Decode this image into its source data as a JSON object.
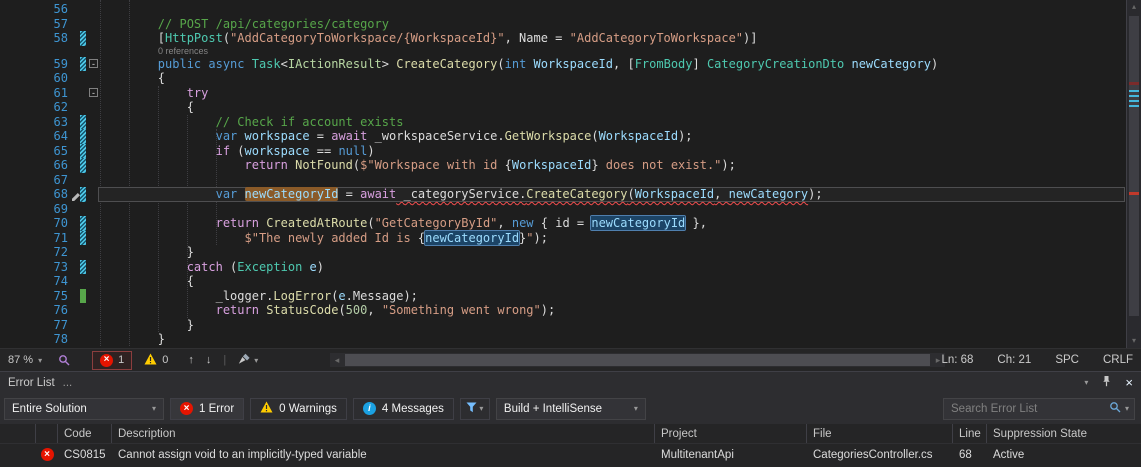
{
  "colors": {
    "editor_background": "#1E1E1E",
    "panel_background": "#2D2D30",
    "error_red": "#E51400",
    "warning_yellow": "#FFCC00",
    "info_blue": "#1BA1E2",
    "reference_highlight": "#1C4466",
    "definition_highlight": "#8A5A28"
  },
  "icons": [
    "error-icon",
    "warning-icon",
    "info-icon",
    "filter-icon",
    "search-icon",
    "pin-icon",
    "close-icon",
    "chevron-down-icon",
    "broom-icon",
    "zoom-icon",
    "pencil-icon",
    "arrow-up-icon",
    "arrow-down-icon"
  ],
  "editor": {
    "statusbar": {
      "zoom": "87 %",
      "error_count": "1",
      "warning_count": "0",
      "line_indicator": "Ln: 68",
      "column_indicator": "Ch: 21",
      "insert_mode": "SPC",
      "line_ending": "CRLF"
    },
    "lines": [
      {
        "n": 56,
        "tokens": []
      },
      {
        "n": 57,
        "tokens": [
          {
            "t": "        // POST /api/categories/category",
            "c": "com"
          }
        ]
      },
      {
        "n": 58,
        "mark": "blue",
        "tokens": [
          {
            "t": "        [",
            "c": "d"
          },
          {
            "t": "HttpPost",
            "c": "t"
          },
          {
            "t": "(",
            "c": "d"
          },
          {
            "t": "\"AddCategoryToWorkspace/{WorkspaceId}\"",
            "c": "s"
          },
          {
            "t": ", Name = ",
            "c": "d"
          },
          {
            "t": "\"AddCategoryToWorkspace\"",
            "c": "s"
          },
          {
            "t": ")]",
            "c": "d"
          }
        ]
      },
      {
        "n": 59,
        "mark": "blue",
        "fold": true,
        "lens": "0 references",
        "tokens": [
          {
            "t": "        public async ",
            "c": "k"
          },
          {
            "t": "Task",
            "c": "t"
          },
          {
            "t": "<",
            "c": "d"
          },
          {
            "t": "IActionResult",
            "c": "i"
          },
          {
            "t": "> ",
            "c": "d"
          },
          {
            "t": "CreateCategory",
            "c": "m"
          },
          {
            "t": "(",
            "c": "d"
          },
          {
            "t": "int ",
            "c": "k"
          },
          {
            "t": "WorkspaceId",
            "c": "v"
          },
          {
            "t": ", [",
            "c": "d"
          },
          {
            "t": "FromBody",
            "c": "t"
          },
          {
            "t": "] ",
            "c": "d"
          },
          {
            "t": "CategoryCreationDto",
            "c": "t"
          },
          {
            "t": " ",
            "c": "d"
          },
          {
            "t": "newCategory",
            "c": "v"
          },
          {
            "t": ")",
            "c": "d"
          }
        ]
      },
      {
        "n": 60,
        "tokens": [
          {
            "t": "        {",
            "c": "d"
          }
        ]
      },
      {
        "n": 61,
        "fold": true,
        "tokens": [
          {
            "t": "            ",
            "c": "d"
          },
          {
            "t": "try",
            "c": "c"
          }
        ]
      },
      {
        "n": 62,
        "tokens": [
          {
            "t": "            {",
            "c": "d"
          }
        ]
      },
      {
        "n": 63,
        "mark": "blue",
        "tokens": [
          {
            "t": "                // Check if account exists",
            "c": "com"
          }
        ]
      },
      {
        "n": 64,
        "mark": "blue",
        "tokens": [
          {
            "t": "                ",
            "c": "d"
          },
          {
            "t": "var",
            "c": "k"
          },
          {
            "t": " ",
            "c": "d"
          },
          {
            "t": "workspace",
            "c": "v"
          },
          {
            "t": " = ",
            "c": "d"
          },
          {
            "t": "await",
            "c": "c"
          },
          {
            "t": " _workspaceService.",
            "c": "d"
          },
          {
            "t": "GetWorkspace",
            "c": "m"
          },
          {
            "t": "(",
            "c": "d"
          },
          {
            "t": "WorkspaceId",
            "c": "v"
          },
          {
            "t": ");",
            "c": "d"
          }
        ]
      },
      {
        "n": 65,
        "mark": "blue",
        "tokens": [
          {
            "t": "                ",
            "c": "d"
          },
          {
            "t": "if",
            "c": "c"
          },
          {
            "t": " (",
            "c": "d"
          },
          {
            "t": "workspace",
            "c": "v"
          },
          {
            "t": " == ",
            "c": "d"
          },
          {
            "t": "null",
            "c": "k"
          },
          {
            "t": ")",
            "c": "d"
          }
        ]
      },
      {
        "n": 66,
        "mark": "blue",
        "tokens": [
          {
            "t": "                    ",
            "c": "d"
          },
          {
            "t": "return",
            "c": "c"
          },
          {
            "t": " ",
            "c": "d"
          },
          {
            "t": "NotFound",
            "c": "m"
          },
          {
            "t": "(",
            "c": "d"
          },
          {
            "t": "$\"Workspace with id ",
            "c": "s"
          },
          {
            "t": "{",
            "c": "d"
          },
          {
            "t": "WorkspaceId",
            "c": "v"
          },
          {
            "t": "}",
            "c": "d"
          },
          {
            "t": " does not exist.\"",
            "c": "s"
          },
          {
            "t": ");",
            "c": "d"
          }
        ]
      },
      {
        "n": 67,
        "tokens": []
      },
      {
        "n": 68,
        "mark": "blue",
        "current": true,
        "tokens": [
          {
            "t": "                ",
            "c": "d"
          },
          {
            "t": "var",
            "c": "k"
          },
          {
            "t": " ",
            "c": "d"
          },
          {
            "t": "newCategoryId",
            "c": "v",
            "hl": "def"
          },
          {
            "t": " = ",
            "c": "d"
          },
          {
            "t": "await",
            "c": "c"
          },
          {
            "t": " _categoryService.",
            "c": "d",
            "sq": true
          },
          {
            "t": "CreateCategory",
            "c": "m",
            "sq": true
          },
          {
            "t": "(",
            "c": "d",
            "sq": true
          },
          {
            "t": "WorkspaceId",
            "c": "v",
            "sq": true
          },
          {
            "t": ", ",
            "c": "d",
            "sq": true
          },
          {
            "t": "newCategory",
            "c": "v",
            "sq": true
          },
          {
            "t": ");",
            "c": "d"
          }
        ]
      },
      {
        "n": 69,
        "tokens": []
      },
      {
        "n": 70,
        "mark": "blue",
        "tokens": [
          {
            "t": "                ",
            "c": "d"
          },
          {
            "t": "return",
            "c": "c"
          },
          {
            "t": " ",
            "c": "d"
          },
          {
            "t": "CreatedAtRoute",
            "c": "m"
          },
          {
            "t": "(",
            "c": "d"
          },
          {
            "t": "\"GetCategoryById\"",
            "c": "s"
          },
          {
            "t": ", ",
            "c": "d"
          },
          {
            "t": "new",
            "c": "k"
          },
          {
            "t": " { id = ",
            "c": "d"
          },
          {
            "t": "newCategoryId",
            "c": "v",
            "hl": "ref"
          },
          {
            "t": " },",
            "c": "d"
          }
        ]
      },
      {
        "n": 71,
        "mark": "blue",
        "tokens": [
          {
            "t": "                    ",
            "c": "d"
          },
          {
            "t": "$\"The newly added Id is ",
            "c": "s"
          },
          {
            "t": "{",
            "c": "d"
          },
          {
            "t": "newCategoryId",
            "c": "v",
            "hl": "ref"
          },
          {
            "t": "}",
            "c": "d"
          },
          {
            "t": "\"",
            "c": "s"
          },
          {
            "t": ");",
            "c": "d"
          }
        ]
      },
      {
        "n": 72,
        "tokens": [
          {
            "t": "            }",
            "c": "d"
          }
        ]
      },
      {
        "n": 73,
        "mark": "blue",
        "tokens": [
          {
            "t": "            ",
            "c": "d"
          },
          {
            "t": "catch",
            "c": "c"
          },
          {
            "t": " (",
            "c": "d"
          },
          {
            "t": "Exception",
            "c": "t"
          },
          {
            "t": " ",
            "c": "d"
          },
          {
            "t": "e",
            "c": "v"
          },
          {
            "t": ")",
            "c": "d"
          }
        ]
      },
      {
        "n": 74,
        "tokens": [
          {
            "t": "            {",
            "c": "d"
          }
        ]
      },
      {
        "n": 75,
        "mark": "green",
        "tokens": [
          {
            "t": "                _logger.",
            "c": "d"
          },
          {
            "t": "LogError",
            "c": "m"
          },
          {
            "t": "(",
            "c": "d"
          },
          {
            "t": "e",
            "c": "v"
          },
          {
            "t": ".Message);",
            "c": "d"
          }
        ]
      },
      {
        "n": 76,
        "tokens": [
          {
            "t": "                ",
            "c": "d"
          },
          {
            "t": "return",
            "c": "c"
          },
          {
            "t": " ",
            "c": "d"
          },
          {
            "t": "StatusCode",
            "c": "m"
          },
          {
            "t": "(",
            "c": "d"
          },
          {
            "t": "500",
            "c": "n"
          },
          {
            "t": ", ",
            "c": "d"
          },
          {
            "t": "\"Something went wrong\"",
            "c": "s"
          },
          {
            "t": ");",
            "c": "d"
          }
        ]
      },
      {
        "n": 77,
        "tokens": [
          {
            "t": "            }",
            "c": "d"
          }
        ]
      },
      {
        "n": 78,
        "tokens": [
          {
            "t": "        }",
            "c": "d"
          }
        ]
      }
    ]
  },
  "error_list": {
    "title": "Error List",
    "title_ellipsis": "...",
    "toolbar": {
      "scope_filter": "Entire Solution",
      "errors_button": "1 Error",
      "warnings_button": "0 Warnings",
      "messages_button": "4 Messages",
      "source_filter": "Build + IntelliSense",
      "search_placeholder": "Search Error List"
    },
    "columns": {
      "code": "Code",
      "description": "Description",
      "project": "Project",
      "file": "File",
      "line": "Line",
      "suppression": "Suppression State"
    },
    "rows": [
      {
        "severity": "error",
        "code": "CS0815",
        "description": "Cannot assign void to an implicitly-typed variable",
        "project": "MultitenantApi",
        "file": "CategoriesController.cs",
        "line": "68",
        "suppression": "Active"
      }
    ]
  }
}
